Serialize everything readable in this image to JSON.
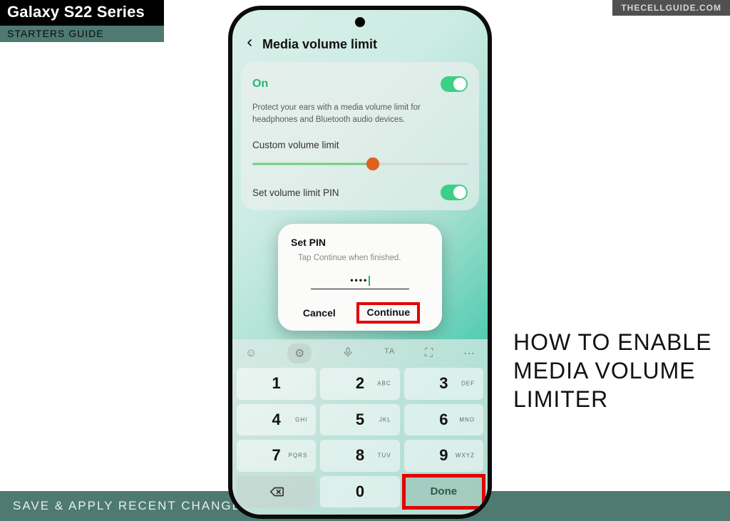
{
  "badge": {
    "top": "Galaxy S22 Series",
    "bottom": "STARTERS GUIDE"
  },
  "watermark": "THECELLGUIDE.COM",
  "footer": "SAVE & APPLY RECENT CHANGES",
  "headline": "HOW TO ENABLE MEDIA VOLUME LIMITER",
  "screen": {
    "header_title": "Media volume limit",
    "on_label": "On",
    "description": "Protect your ears with a media volume limit for headphones and Bluetooth audio devices.",
    "custom_label": "Custom volume limit",
    "pin_label": "Set volume limit PIN"
  },
  "dialog": {
    "title": "Set PIN",
    "subtitle": "Tap Continue when finished.",
    "pin_masked": "••••",
    "cancel": "Cancel",
    "continue": "Continue"
  },
  "keypad": {
    "keys": [
      {
        "num": "1",
        "sub": ""
      },
      {
        "num": "2",
        "sub": "ABC"
      },
      {
        "num": "3",
        "sub": "DEF"
      },
      {
        "num": "4",
        "sub": "GHI"
      },
      {
        "num": "5",
        "sub": "JKL"
      },
      {
        "num": "6",
        "sub": "MNO"
      },
      {
        "num": "7",
        "sub": "PQRS"
      },
      {
        "num": "8",
        "sub": "TUV"
      },
      {
        "num": "9",
        "sub": "WXYZ"
      }
    ],
    "zero": "0",
    "done": "Done"
  }
}
